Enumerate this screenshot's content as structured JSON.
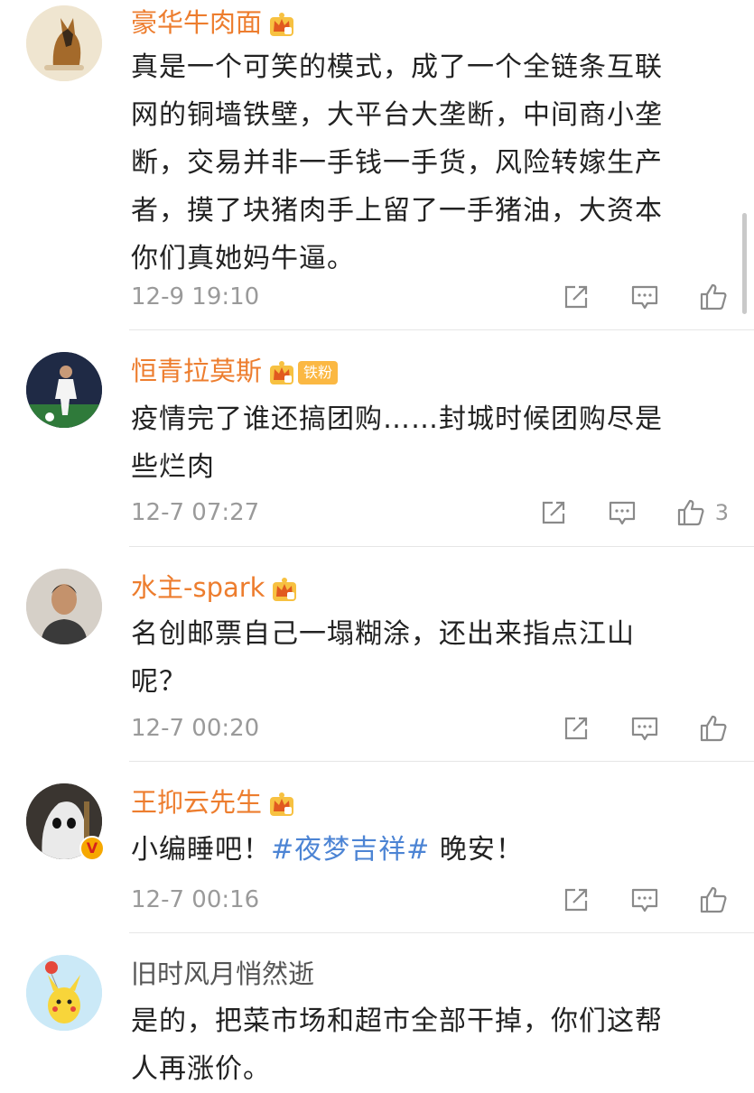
{
  "comments": [
    {
      "user": "豪华牛肉面",
      "lines": [
        "真是一个可笑的模式，成了一个全链条互联",
        "网的铜墙铁壁，大平台大垄断，中间商小垄",
        "断，交易并非一手钱一手货，风险转嫁生产",
        "者，摸了块猪肉手上留了一手猪油，大资本",
        "你们真她妈牛逼。"
      ],
      "time": "12-9 19:10",
      "likes": ""
    },
    {
      "user": "恒青拉莫斯",
      "fan_badge": "铁粉",
      "lines": [
        "疫情完了谁还搞团购……封城时候团购尽是",
        "些烂肉"
      ],
      "time": "12-7 07:27",
      "likes": "3"
    },
    {
      "user": "水主-spark",
      "lines": [
        "名创邮票自己一塌糊涂，还出来指点江山",
        "呢？"
      ],
      "time": "12-7 00:20",
      "likes": ""
    },
    {
      "user": "王抑云先生",
      "text_before": "小编睡吧！",
      "hashtag": "#夜梦吉祥#",
      "text_after": " 晚安！",
      "time": "12-7 00:16",
      "likes": ""
    },
    {
      "user": "旧时风月悄然逝",
      "lines": [
        "是的，把菜市场和超市全部干掉，你们这帮",
        "人再涨价。"
      ]
    }
  ],
  "icons": {
    "share": "share-icon",
    "comment": "comment-icon",
    "like": "thumbs-up-icon",
    "crown": "crown-badge-icon",
    "verified": "verified-v-icon"
  },
  "colors": {
    "vip_name": "#ed7d2e",
    "plain_name": "#555555",
    "hashtag": "#4c84d4",
    "meta": "#9a9a9a"
  },
  "verified_mark": "V"
}
